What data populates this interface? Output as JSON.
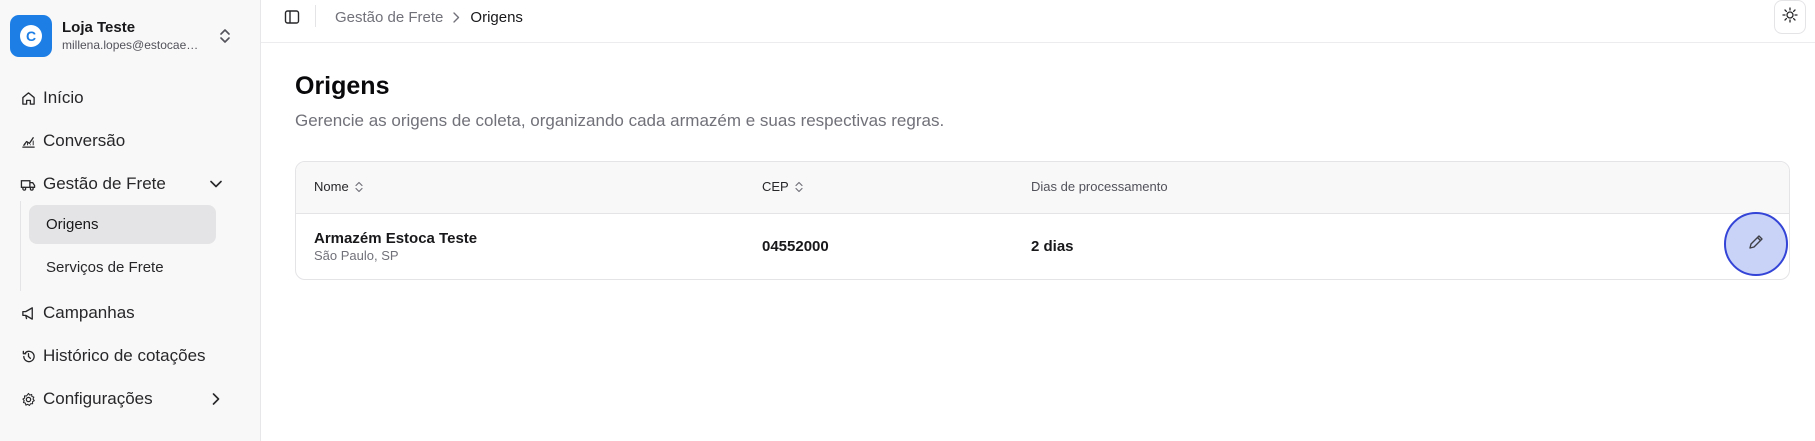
{
  "account": {
    "avatar_letter": "C",
    "name": "Loja Teste",
    "email": "millena.lopes@estocaestoca.com.br"
  },
  "sidebar": {
    "items": [
      {
        "label": "Início",
        "icon": "home-icon"
      },
      {
        "label": "Conversão",
        "icon": "chart-line-icon"
      },
      {
        "label": "Gestão de Frete",
        "icon": "truck-icon",
        "expanded": true
      },
      {
        "label": "Campanhas",
        "icon": "megaphone-icon"
      },
      {
        "label": "Histórico de cotações",
        "icon": "history-icon"
      },
      {
        "label": "Configurações",
        "icon": "gear-icon"
      }
    ],
    "sub_items": [
      {
        "label": "Origens",
        "active": true
      },
      {
        "label": "Serviços de Frete",
        "active": false
      }
    ]
  },
  "breadcrumb": {
    "parent": "Gestão de Frete",
    "current": "Origens"
  },
  "page": {
    "title": "Origens",
    "subtitle": "Gerencie as origens de coleta, organizando cada armazém e suas respectivas regras."
  },
  "table": {
    "columns": [
      {
        "label": "Nome",
        "sortable": true
      },
      {
        "label": "CEP",
        "sortable": true
      },
      {
        "label": "Dias de processamento",
        "sortable": false
      }
    ],
    "rows": [
      {
        "name": "Armazém Estoca Teste",
        "location": "São Paulo, SP",
        "cep": "04552000",
        "days": "2 dias"
      }
    ]
  },
  "colors": {
    "accent": "#1d7fe6",
    "edit_button_fill": "#c9d3f7",
    "edit_button_border": "#3344d6"
  }
}
